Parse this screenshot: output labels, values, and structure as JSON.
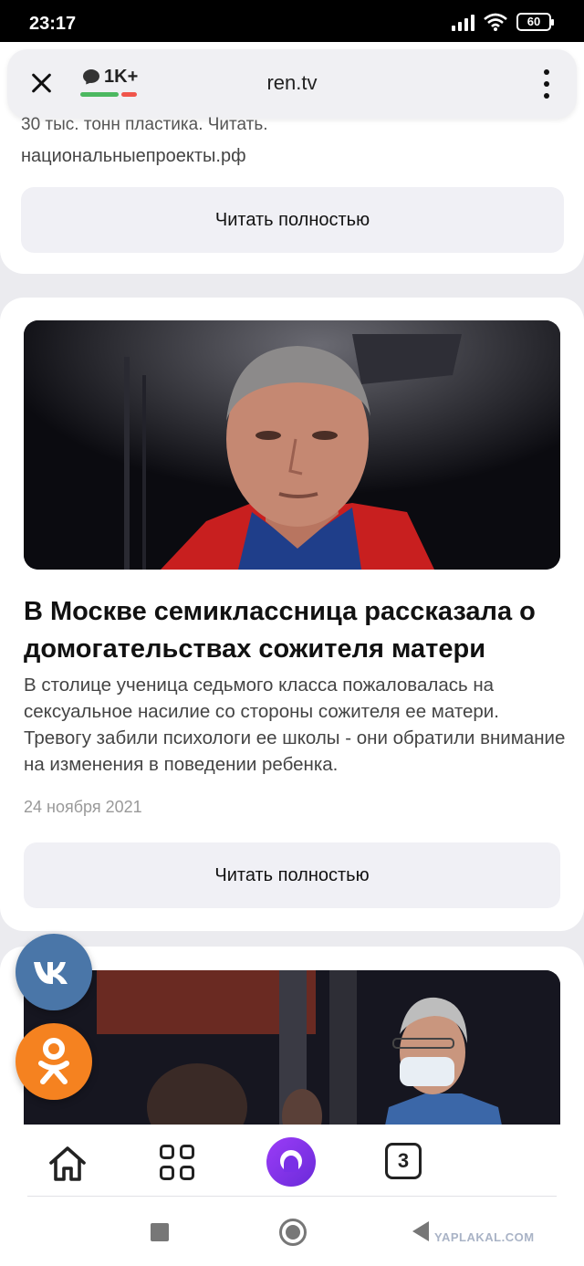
{
  "status_bar": {
    "time": "23:17",
    "battery": "60"
  },
  "browser": {
    "comments_count": "1K+",
    "domain": "ren.tv"
  },
  "feed": {
    "prev_card": {
      "cut_text": "30 тыс. тонн пластика.  Читать.",
      "source": "национальныепроекты.рф",
      "read_more": "Читать полностью"
    },
    "article": {
      "title": "В Москве семиклассница рассказала о домогательствах сожителя матери",
      "lead": "В столице ученица седьмого класса пожаловалась на сексуальное насилие со стороны сожителя ее матери. Тревогу забили психологи ее школы - они обратили внимание на изменения в поведении ребенка.",
      "date": "24 ноября 2021",
      "read_more": "Читать полностью"
    }
  },
  "social": {
    "vk_label": "VK",
    "ok_label": "OK"
  },
  "bottom_nav": {
    "tabs_count": "3"
  },
  "watermark": "YAPLAKAL.COM",
  "icons": [
    "close-icon",
    "comment-icon",
    "more-vertical-icon",
    "vk-icon",
    "odnoklassniki-icon",
    "home-icon",
    "services-grid-icon",
    "alice-icon",
    "tabs-icon",
    "recent-apps-icon",
    "home-circle-icon",
    "back-icon"
  ],
  "colors": {
    "vk": "#4a76a8",
    "ok": "#f58220",
    "alice": "#7a30e6",
    "positive": "#4cb860",
    "negative": "#f0554b"
  }
}
